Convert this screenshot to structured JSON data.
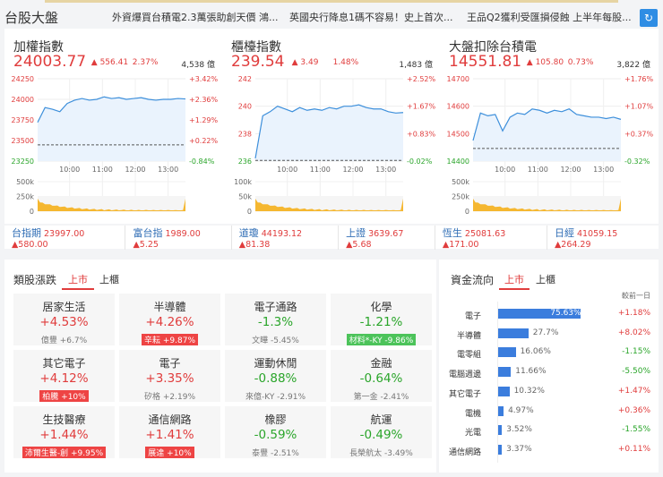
{
  "header": {
    "title": "台股大盤",
    "news": [
      "外資爆買台積電2.3萬張助創天價 鴻...",
      "英國央行降息1碼不容易！史上首次...",
      "王品Q2獲利受匯損侵蝕 上半年每股..."
    ],
    "refresh_icon": "refresh-icon"
  },
  "indices": [
    {
      "name": "加權指數",
      "price": "24003.77",
      "change": "▲ 556.41",
      "pct": "2.37%",
      "volume": "4,538 億",
      "yticks": [
        "24250",
        "24000",
        "23750",
        "23500",
        "23250"
      ],
      "pticks": [
        "+3.42%",
        "+2.36%",
        "+1.29%",
        "+0.22%",
        "-0.84%"
      ],
      "vticks": [
        "500k",
        "250k",
        "0"
      ],
      "xticks": [
        "10:00",
        "11:00",
        "12:00",
        "13:00"
      ]
    },
    {
      "name": "櫃檯指數",
      "price": "239.54",
      "change": "▲ 3.49",
      "pct": "1.48%",
      "volume": "1,483 億",
      "yticks": [
        "242",
        "240",
        "238",
        "236"
      ],
      "pticks": [
        "+2.52%",
        "+1.67%",
        "+0.83%",
        "-0.02%"
      ],
      "vticks": [
        "100k",
        "50k",
        "0"
      ],
      "xticks": [
        "10:00",
        "11:00",
        "12:00",
        "13:00"
      ]
    },
    {
      "name": "大盤扣除台積電",
      "price": "14551.81",
      "change": "▲ 105.80",
      "pct": "0.73%",
      "volume": "3,822 億",
      "yticks": [
        "14700",
        "14600",
        "14500",
        "14400"
      ],
      "pticks": [
        "+1.76%",
        "+1.07%",
        "+0.37%",
        "-0.32%"
      ],
      "vticks": [
        "500k",
        "250k",
        "0"
      ],
      "xticks": [
        "10:00",
        "11:00",
        "12:00",
        "13:00"
      ]
    }
  ],
  "chart_data": [
    {
      "type": "line",
      "title": "加權指數",
      "ylim": [
        23250,
        24250
      ],
      "ref": 23447,
      "x": [
        "9:00",
        "13:30"
      ],
      "values": [
        23720,
        23900,
        23880,
        23850,
        23950,
        23990,
        24010,
        23990,
        24000,
        24030,
        24010,
        24020,
        24000,
        24010,
        24020,
        24000,
        23990,
        24000,
        24000,
        24010,
        24005
      ]
    },
    {
      "type": "line",
      "title": "櫃檯指數",
      "ylim": [
        236,
        242
      ],
      "ref": 236.05,
      "x": [
        "9:00",
        "13:30"
      ],
      "values": [
        236.2,
        239.3,
        239.6,
        240.0,
        239.8,
        239.6,
        239.9,
        239.7,
        239.8,
        239.7,
        239.9,
        239.8,
        240.0,
        240.0,
        240.1,
        239.9,
        239.8,
        239.8,
        239.6,
        239.5,
        239.54
      ]
    },
    {
      "type": "line",
      "title": "大盤扣除台積電",
      "ylim": [
        14400,
        14700
      ],
      "ref": 14446,
      "x": [
        "9:00",
        "13:30"
      ],
      "values": [
        14475,
        14575,
        14565,
        14570,
        14510,
        14560,
        14575,
        14570,
        14590,
        14585,
        14575,
        14585,
        14580,
        14590,
        14570,
        14565,
        14560,
        14560,
        14555,
        14560,
        14552
      ]
    }
  ],
  "futures": [
    {
      "name": "台指期",
      "value": "23997.00 ▲580.00"
    },
    {
      "name": "富台指",
      "value": "1989.00 ▲5.25"
    },
    {
      "name": "道瓊",
      "value": "44193.12 ▲81.38"
    },
    {
      "name": "上證",
      "value": "3639.67 ▲5.68"
    },
    {
      "name": "恆生",
      "value": "25081.63 ▲171.00"
    },
    {
      "name": "日經",
      "value": "41059.15 ▲264.29"
    }
  ],
  "sectors": {
    "title": "類股漲跌",
    "tabs": [
      "上市",
      "上櫃"
    ],
    "items": [
      {
        "name": "居家生活",
        "pct": "+4.53%",
        "sub": "億豐 +6.7%",
        "dir": "up",
        "hl": ""
      },
      {
        "name": "半導體",
        "pct": "+4.26%",
        "sub": "辛耘 +9.87%",
        "dir": "up",
        "hl": "bu"
      },
      {
        "name": "電子通路",
        "pct": "-1.3%",
        "sub": "文曄 -5.45%",
        "dir": "dn",
        "hl": ""
      },
      {
        "name": "化學",
        "pct": "-1.21%",
        "sub": "材料*-KY -9.86%",
        "dir": "dn",
        "hl": "bd"
      },
      {
        "name": "其它電子",
        "pct": "+4.12%",
        "sub": "柏騰 +10%",
        "dir": "up",
        "hl": "bu"
      },
      {
        "name": "電子",
        "pct": "+3.35%",
        "sub": "矽格 +2.19%",
        "dir": "up",
        "hl": ""
      },
      {
        "name": "運動休閒",
        "pct": "-0.88%",
        "sub": "來億-KY -2.91%",
        "dir": "dn",
        "hl": ""
      },
      {
        "name": "金融",
        "pct": "-0.64%",
        "sub": "第一金 -2.41%",
        "dir": "dn",
        "hl": ""
      },
      {
        "name": "生技醫療",
        "pct": "+1.44%",
        "sub": "沛爾生醫-創 +9.95%",
        "dir": "up",
        "hl": "bu"
      },
      {
        "name": "通信網路",
        "pct": "+1.41%",
        "sub": "展達 +10%",
        "dir": "up",
        "hl": "bu"
      },
      {
        "name": "橡膠",
        "pct": "-0.59%",
        "sub": "泰豐 -2.51%",
        "dir": "dn",
        "hl": ""
      },
      {
        "name": "航運",
        "pct": "-0.49%",
        "sub": "長榮航太 -3.49%",
        "dir": "dn",
        "hl": ""
      }
    ]
  },
  "flow": {
    "title": "資金流向",
    "tabs": [
      "上市",
      "上櫃"
    ],
    "compare_label": "較前一日",
    "items": [
      {
        "name": "電子",
        "share": 75.63,
        "label": "75.63%",
        "change": "+1.18%",
        "dir": "up"
      },
      {
        "name": "半導體",
        "share": 27.7,
        "label": "27.7%",
        "change": "+8.02%",
        "dir": "up"
      },
      {
        "name": "電零組",
        "share": 16.06,
        "label": "16.06%",
        "change": "-1.15%",
        "dir": "dn"
      },
      {
        "name": "電腦週邊",
        "share": 11.66,
        "label": "11.66%",
        "change": "-5.50%",
        "dir": "dn"
      },
      {
        "name": "其它電子",
        "share": 10.32,
        "label": "10.32%",
        "change": "+1.47%",
        "dir": "up"
      },
      {
        "name": "電機",
        "share": 4.97,
        "label": "4.97%",
        "change": "+0.36%",
        "dir": "up"
      },
      {
        "name": "光電",
        "share": 3.52,
        "label": "3.52%",
        "change": "-1.55%",
        "dir": "dn"
      },
      {
        "name": "通信網路",
        "share": 3.37,
        "label": "3.37%",
        "change": "+0.11%",
        "dir": "up"
      }
    ]
  }
}
